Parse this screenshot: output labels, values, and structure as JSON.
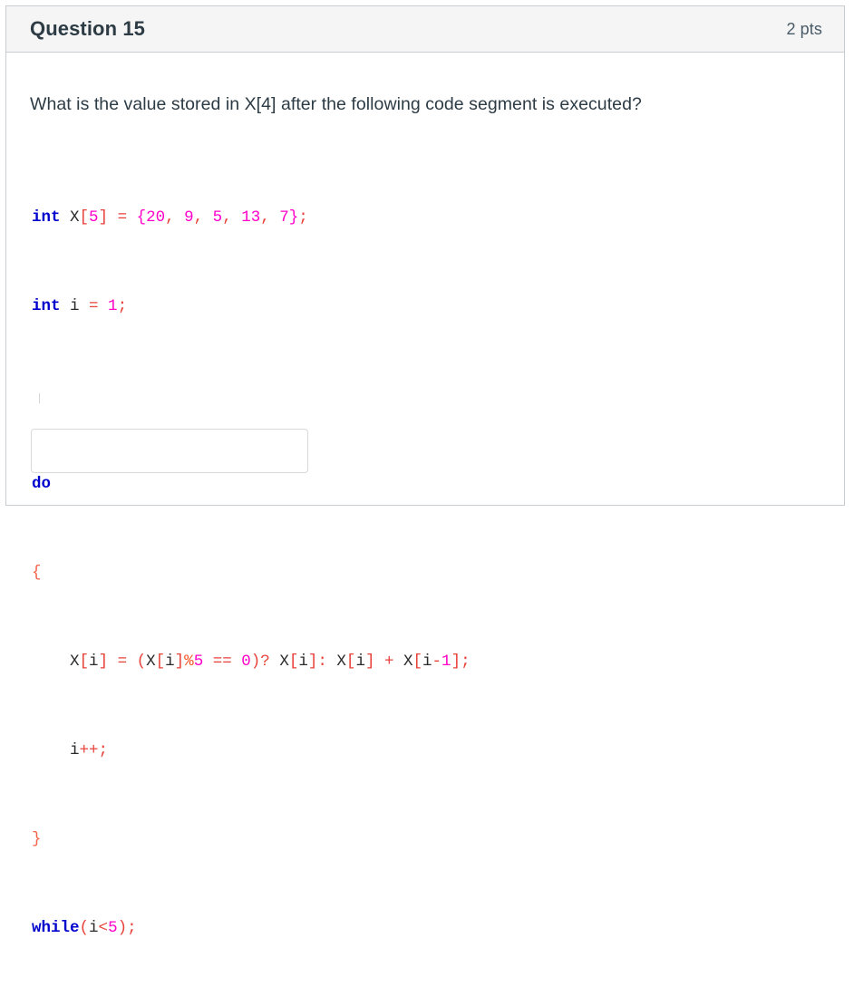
{
  "header": {
    "title": "Question 15",
    "points": "2 pts"
  },
  "prompt": "What is the value stored in X[4] after the following code segment is executed?",
  "code": {
    "line1_kw": "int",
    "line1_ident_a": " X",
    "line1_brk_open": "[",
    "line1_size": "5",
    "line1_brk_close": "]",
    "line1_eq": " = ",
    "line1_brace_open": "{",
    "line1_v0": "20",
    "line1_c0": ", ",
    "line1_v1": "9",
    "line1_c1": ", ",
    "line1_v2": "5",
    "line1_c2": ", ",
    "line1_v3": "13",
    "line1_c3": ", ",
    "line1_v4": "7",
    "line1_brace_close": "}",
    "line1_semi": ";",
    "line2_kw": "int",
    "line2_ident": " i",
    "line2_eq": " = ",
    "line2_val": "1",
    "line2_semi": ";",
    "line4_kw": "do",
    "line5_brace": "{",
    "line6_indent": "    ",
    "line6_lhs": "X",
    "line6_lhs_brk_open": "[",
    "line6_lhs_idx": "i",
    "line6_lhs_brk_close": "]",
    "line6_eq": " = ",
    "line6_paren_open": "(",
    "line6_a": "X",
    "line6_a_brk_open": "[",
    "line6_a_idx": "i",
    "line6_a_brk_close": "]",
    "line6_mod": "%",
    "line6_mod_val": "5",
    "line6_sp1": " ",
    "line6_cmp": "==",
    "line6_sp2": " ",
    "line6_zero": "0",
    "line6_paren_close": ")",
    "line6_q": "?",
    "line6_sp3": " ",
    "line6_t": "X",
    "line6_t_brk_open": "[",
    "line6_t_idx": "i",
    "line6_t_brk_close": "]",
    "line6_colon": ":",
    "line6_sp4": " ",
    "line6_f1": "X",
    "line6_f1_brk_open": "[",
    "line6_f1_idx": "i",
    "line6_f1_brk_close": "]",
    "line6_plus": " + ",
    "line6_f2": "X",
    "line6_f2_brk_open": "[",
    "line6_f2_idx": "i",
    "line6_f2_minus": "-",
    "line6_f2_one": "1",
    "line6_f2_brk_close": "]",
    "line6_semi": ";",
    "line7_indent": "    ",
    "line7_ident": "i",
    "line7_inc": "++",
    "line7_semi": ";",
    "line8_brace": "}",
    "line9_kw": "while",
    "line9_paren_open": "(",
    "line9_ident": "i",
    "line9_lt": "<",
    "line9_val": "5",
    "line9_paren_close": ")",
    "line9_semi": ";"
  },
  "answer": {
    "value": "",
    "placeholder": ""
  },
  "colors": {
    "header_bg": "#f5f5f5",
    "border": "#c7cdd1",
    "title": "#2d3b45",
    "keyword": "#0000cd",
    "number": "#ff00c8",
    "punct": "#e8413a",
    "identifier": "#2a2a2a"
  }
}
